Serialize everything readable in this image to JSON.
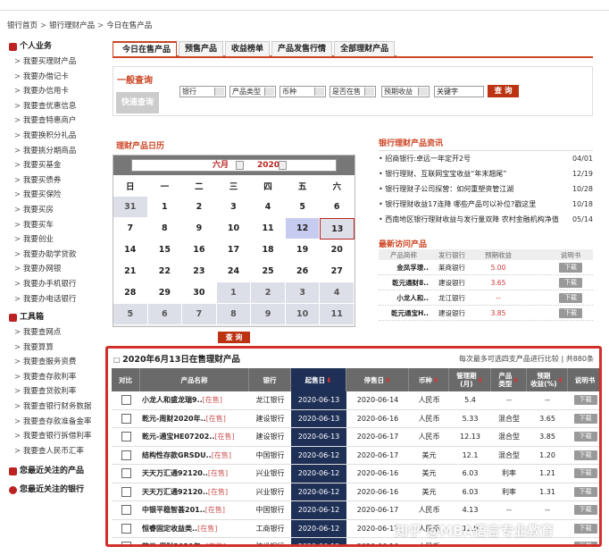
{
  "breadcrumb": [
    "银行首页",
    "银行理财产品",
    "今日在售产品"
  ],
  "sidebar": {
    "personal_title": "个人业务",
    "personal": [
      "我要买理财产品",
      "我要办借记卡",
      "我要办信用卡",
      "我要查优惠信息",
      "我要查特惠商户",
      "我要换积分礼品",
      "我要挑分期商品",
      "我要买基金",
      "我要买债券",
      "我要买保险",
      "我要买房",
      "我要买车",
      "我要创业",
      "我要办助学贷款",
      "我要办网银",
      "我要办手机银行",
      "我要办电话银行"
    ],
    "tools_title": "工具箱",
    "tools": [
      "我要查网点",
      "我要算算",
      "我要查服务资费",
      "我要查存款利率",
      "我要查贷款利率",
      "我要查银行财务数据",
      "我要查存款准备金率",
      "我要查银行拆借利率",
      "我要查人民币汇率"
    ],
    "recent_title": "您最近关注的产品",
    "follow_title": "您最近关注的银行"
  },
  "tabs": [
    "今日在售产品",
    "预售产品",
    "收益榜单",
    "产品发售行情",
    "全部理财产品"
  ],
  "query": {
    "label": "一般查询",
    "fast": "快速查询",
    "selects": [
      "银行",
      "产品类型",
      "币种",
      "是否在售",
      "预期收益"
    ],
    "keyword": "关键字",
    "submit": "查 询"
  },
  "calendar": {
    "title": "理财产品日历",
    "month": "六月",
    "year": "2020",
    "weekdays": [
      "日",
      "一",
      "二",
      "三",
      "四",
      "五",
      "六"
    ],
    "days": [
      [
        "31",
        "1",
        "2",
        "3",
        "4",
        "5",
        "6"
      ],
      [
        "7",
        "8",
        "9",
        "10",
        "11",
        "12",
        "13"
      ],
      [
        "14",
        "15",
        "16",
        "17",
        "18",
        "19",
        "20"
      ],
      [
        "21",
        "22",
        "23",
        "24",
        "25",
        "26",
        "27"
      ],
      [
        "28",
        "29",
        "30",
        "1",
        "2",
        "3",
        "4"
      ],
      [
        "5",
        "6",
        "7",
        "8",
        "9",
        "10",
        "11"
      ]
    ],
    "query_btn": "查 询"
  },
  "news": {
    "title": "银行理财产品资讯",
    "items": [
      {
        "t": "招商银行:卓远一年定开2号",
        "d": "04/01"
      },
      {
        "t": "银行理财、互联网宝宝收益“年末翘尾”",
        "d": "12/19"
      },
      {
        "t": "银行理财子公司探营：如何重塑资管江湖",
        "d": "10/28"
      },
      {
        "t": "银行理财收益17连降 哪些产品可以补位?戳这里",
        "d": "10/18"
      },
      {
        "t": "西南地区银行理财收益与发行量双降 农村金融机构净值",
        "d": "05/14"
      }
    ]
  },
  "recent": {
    "title": "最新访问产品",
    "headers": [
      "产品简称",
      "发行银行",
      "预期收益",
      "说明书"
    ],
    "rows": [
      [
        "金凤孚璟..",
        "莱商银行",
        "5.00"
      ],
      [
        "乾元通财8..",
        "建设银行",
        "3.65"
      ],
      [
        "小龙人和..",
        "龙江银行",
        "--"
      ],
      [
        "乾元通宝H..",
        "建设银行",
        "3.85"
      ]
    ],
    "dl": "下载"
  },
  "table": {
    "title": "2020年6月13日在售理财产品",
    "note": "每次最多可选四支产品进行比较 | 共880条",
    "headers": [
      "对比",
      "产品名称",
      "银行",
      "起售日",
      "停售日",
      "币种",
      "管理期\n(月)",
      "产品\n类型",
      "预期\n收益(%)",
      "说明书"
    ],
    "rows": [
      [
        "小龙人和盛龙瑞9..",
        "龙江银行",
        "2020-06-13",
        "2020-06-14",
        "人民币",
        "5.4",
        "--",
        "--"
      ],
      [
        "乾元-周财2020年..",
        "建设银行",
        "2020-06-13",
        "2020-06-16",
        "人民币",
        "5.33",
        "混合型",
        "3.65"
      ],
      [
        "乾元-通宝HE07202..",
        "建设银行",
        "2020-06-13",
        "2020-06-17",
        "人民币",
        "12.13",
        "混合型",
        "3.85"
      ],
      [
        "结构性存款GRSDU..",
        "中国银行",
        "2020-06-12",
        "2020-06-17",
        "美元",
        "12.1",
        "混合型",
        "1.20"
      ],
      [
        "天天万汇通92120..",
        "兴业银行",
        "2020-06-12",
        "2020-06-16",
        "美元",
        "6.03",
        "利率",
        "1.21"
      ],
      [
        "天天万汇通92120..",
        "兴业银行",
        "2020-06-12",
        "2020-06-16",
        "美元",
        "6.03",
        "利率",
        "1.31"
      ],
      [
        "中银平稳智荟201..",
        "中国银行",
        "2020-06-12",
        "2020-06-17",
        "人民币",
        "4.13",
        "--",
        "--"
      ],
      [
        "恒睿固定收益类..",
        "工商银行",
        "2020-06-12",
        "2020-06-17",
        "人民币",
        "11.9",
        "--",
        "--"
      ],
      [
        "乾元-周财2020年..",
        "建设银行",
        "2020-06-12",
        "2020-06-16",
        "人民币",
        "--",
        "--",
        "--"
      ]
    ],
    "status": "[在售]",
    "dl": "下载"
  },
  "watermark": "知乎 @MBA语言专业教育"
}
